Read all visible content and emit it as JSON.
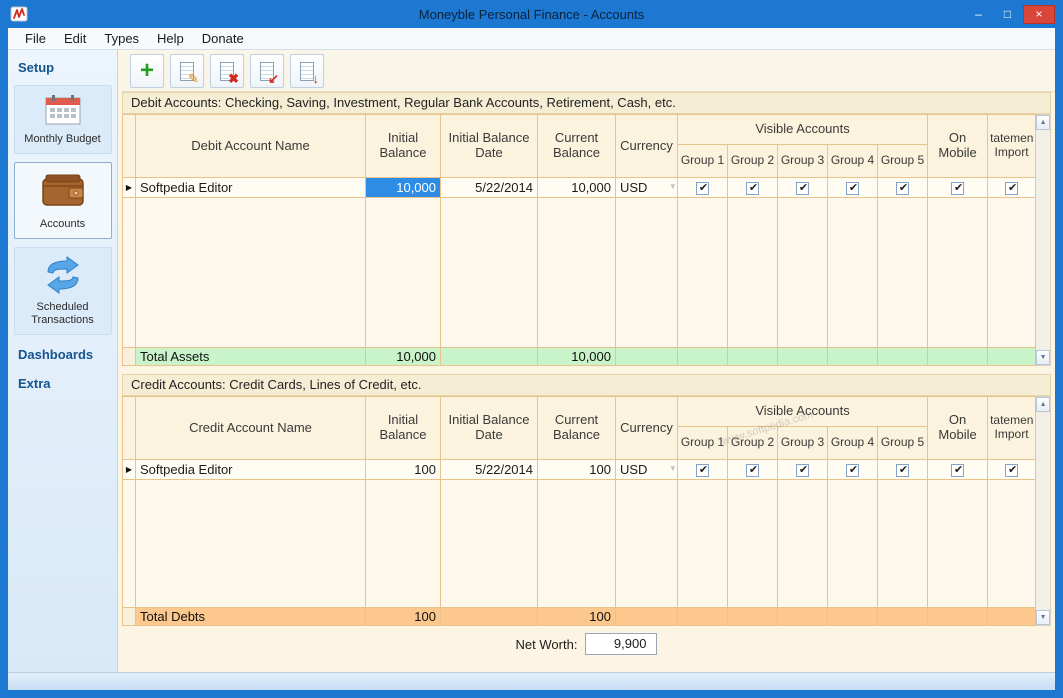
{
  "window": {
    "title": "Moneyble Personal Finance - Accounts"
  },
  "glyphs": {
    "minimize": "–",
    "maximize": "□",
    "close": "×",
    "check": "✔",
    "row_marker": "▶",
    "dropdown": "▾",
    "scroll_up": "▲",
    "scroll_down": "▼"
  },
  "icons": {
    "add": "+",
    "edit": "✎",
    "delete": "✖",
    "import": "↙",
    "export": "↓"
  },
  "menu": {
    "items": [
      {
        "label": "File"
      },
      {
        "label": "Edit"
      },
      {
        "label": "Types"
      },
      {
        "label": "Help"
      },
      {
        "label": "Donate"
      }
    ]
  },
  "sidebar": {
    "setup_label": "Setup",
    "monthly_budget_label": "Monthly Budget",
    "accounts_label": "Accounts",
    "scheduled_label_line1": "Scheduled",
    "scheduled_label_line2": "Transactions",
    "dashboards_label": "Dashboards",
    "extra_label": "Extra"
  },
  "table_headers": {
    "initial_balance": "Initial Balance",
    "initial_balance_date": "Initial Balance Date",
    "current_balance": "Current Balance",
    "currency": "Currency",
    "visible_accounts": "Visible Accounts",
    "groups": [
      "Group 1",
      "Group 2",
      "Group 3",
      "Group 4",
      "Group 5"
    ],
    "on_mobile": "On Mobile",
    "statement_import_line1": "tatemen",
    "statement_import_line2": "Import"
  },
  "debit_table": {
    "section_title": "Debit Accounts: Checking, Saving, Investment, Regular Bank Accounts, Retirement, Cash, etc.",
    "name_header": "Debit Account Name",
    "row": {
      "name": "Softpedia Editor",
      "initial_balance": "10,000",
      "initial_balance_date": "5/22/2014",
      "current_balance": "10,000",
      "currency": "USD",
      "visible_groups": [
        true,
        true,
        true,
        true,
        true
      ],
      "on_mobile": true,
      "statement_import": true
    },
    "total": {
      "label": "Total Assets",
      "initial_balance": "10,000",
      "current_balance": "10,000"
    }
  },
  "credit_table": {
    "section_title": "Credit Accounts: Credit Cards, Lines of Credit, etc.",
    "name_header": "Credit Account Name",
    "row": {
      "name": "Softpedia Editor",
      "initial_balance": "100",
      "initial_balance_date": "5/22/2014",
      "current_balance": "100",
      "currency": "USD",
      "visible_groups": [
        true,
        true,
        true,
        true,
        true
      ],
      "on_mobile": true,
      "statement_import": true
    },
    "total": {
      "label": "Total Debts",
      "initial_balance": "100",
      "current_balance": "100"
    }
  },
  "net_worth": {
    "label": "Net Worth:",
    "value": "9,900"
  },
  "watermark": "www.softpedia.com"
}
